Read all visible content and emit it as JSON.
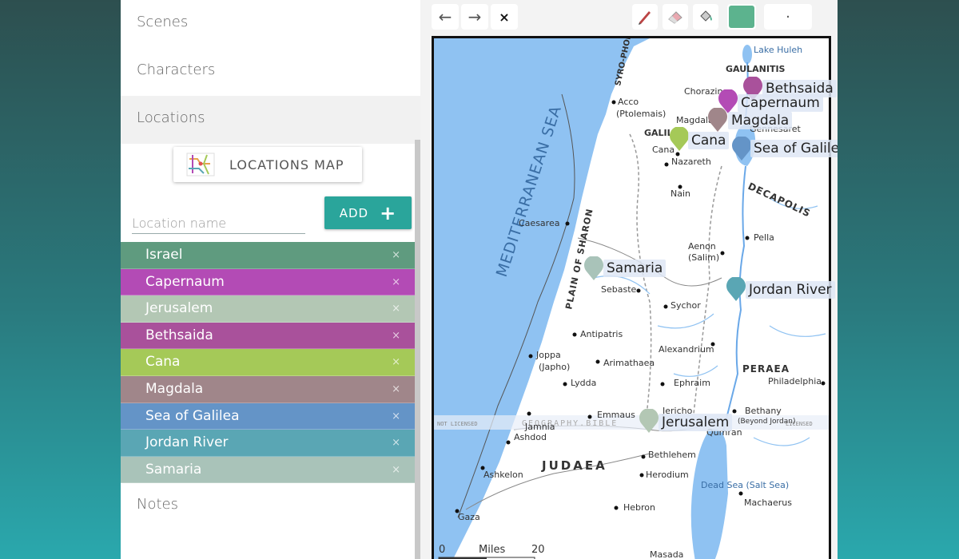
{
  "sidebar": {
    "nav": [
      "Scenes",
      "Characters",
      "Locations",
      "Notes"
    ],
    "map_button_label": "LOCATIONS MAP",
    "location_input": {
      "placeholder": "Location name",
      "value": ""
    },
    "add_button_label": "ADD",
    "locations": [
      {
        "name": "Israel",
        "color": "#5f9b7f"
      },
      {
        "name": "Capernaum",
        "color": "#b34bb5"
      },
      {
        "name": "Jerusalem",
        "color": "#b3c7b4"
      },
      {
        "name": "Bethsaida",
        "color": "#a9519b"
      },
      {
        "name": "Cana",
        "color": "#a5c958"
      },
      {
        "name": "Magdala",
        "color": "#a0868a"
      },
      {
        "name": "Sea of Galilea",
        "color": "#6494c7"
      },
      {
        "name": "Jordan River",
        "color": "#5aa6b4"
      },
      {
        "name": "Samaria",
        "color": "#a9c3b9"
      }
    ],
    "remove_glyph": "×"
  },
  "toolbar": {
    "undo": "←",
    "redo": "→",
    "close": "×",
    "active_color": "#5cb38e",
    "brush_size_dot": "·"
  },
  "map": {
    "sea_label": "MEDITERRANEAN SEA",
    "regions": [
      "GAULANITIS",
      "GALILEE",
      "DECAPOLIS",
      "PERAEA",
      "JUDAEA",
      "PLAIN OF SHARON",
      "SYRO-PHOENICIA"
    ],
    "places": [
      "Lake Huleh",
      "Chorazin",
      "Magdala",
      "Gennesaret",
      "Acco",
      "(Ptolemais)",
      "Cana",
      "Nazareth",
      "Nain",
      "Caesarea",
      "Pella",
      "Aenon",
      "(Salim)",
      "Sebaste",
      "Sychor",
      "Antipatris",
      "Joppa",
      "(Japho)",
      "Arimathaea",
      "Alexandrium",
      "Lydda",
      "Ephraim",
      "Philadelphia",
      "Emmaus",
      "Jericho",
      "Bethany",
      "(Beyond Jordan)",
      "Jamnia",
      "Ashdod",
      "Bethlehem",
      "Ashkelon",
      "Herodium",
      "Gaza",
      "Hebron",
      "Machaerus",
      "Masada",
      "Dead Sea (Salt Sea)",
      "Qumran"
    ],
    "scale": {
      "zero": "0",
      "unit": "Miles",
      "twenty": "20"
    },
    "watermark": "NOT LICENSED  —  GEOGRAPHY.BIBLE  —  LICENSED",
    "pins": [
      {
        "label": "Bethsaida",
        "color": "#a9519b"
      },
      {
        "label": "Capernaum",
        "color": "#b34bb5"
      },
      {
        "label": "Magdala",
        "color": "#a0868a"
      },
      {
        "label": "Cana",
        "color": "#a5c958"
      },
      {
        "label": "Sea of Galilea",
        "color": "#6494c7"
      },
      {
        "label": "Samaria",
        "color": "#a9c3b9"
      },
      {
        "label": "Jordan River",
        "color": "#5aa6b4"
      },
      {
        "label": "Jerusalem",
        "color": "#b3c7b4"
      }
    ]
  }
}
